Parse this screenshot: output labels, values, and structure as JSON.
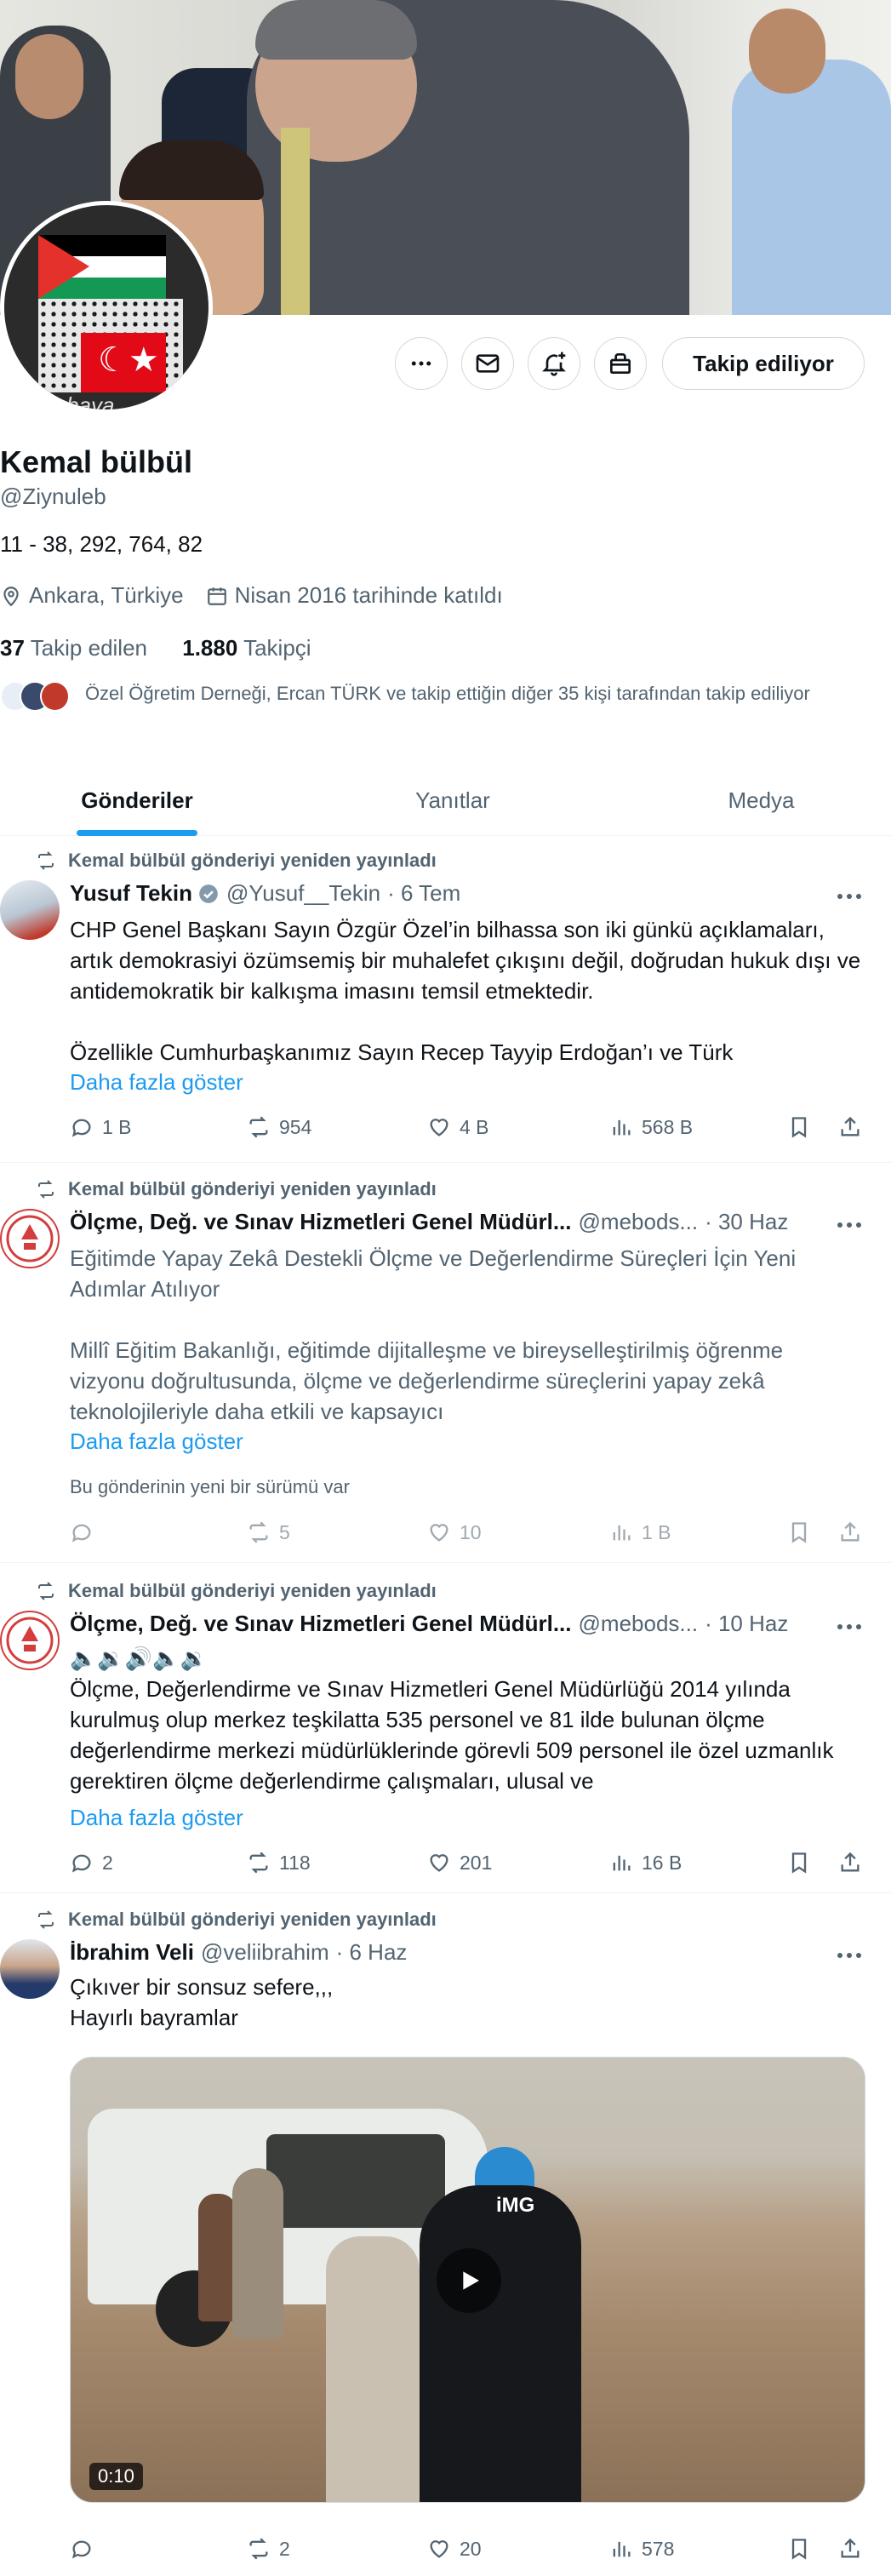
{
  "profile": {
    "name": "Kemal bülbül",
    "handle": "@Ziynuleb",
    "bio": "11 - 38, 292, 764, 82",
    "location": "Ankara, Türkiye",
    "joined": "Nisan 2016 tarihinde katıldı",
    "following_count": "37",
    "following_label": "Takip edilen",
    "followers_count": "1.880",
    "followers_label": "Takipçi",
    "followed_by": "Özel Öğretim Derneği, Ercan TÜRK ve takip ettiğin diğer 35 kişi tarafından takip ediliyor",
    "avatar_watermark": "ncerebaya"
  },
  "actions": {
    "more_icon": "more-icon",
    "message_icon": "mail-icon",
    "notify_icon": "bell-plus-icon",
    "subscribe_icon": "gift-icon",
    "follow_label": "Takip ediliyor"
  },
  "tabs": [
    {
      "label": "Gönderiler",
      "active": true
    },
    {
      "label": "Yanıtlar",
      "active": false
    },
    {
      "label": "Medya",
      "active": false
    }
  ],
  "posts": [
    {
      "repost_label": "Kemal bülbül gönderiyi yeniden yayınladı",
      "author": "Yusuf Tekin",
      "handle": "@Yusuf__Tekin",
      "time": "· 6 Tem",
      "verified": true,
      "body1": "CHP Genel Başkanı Sayın Özgür Özel’in bilhassa son iki günkü açıklamaları, artık demokrasiyi özümsemiş bir muhalefet çıkışını değil, doğrudan hukuk dışı ve antidemokratik bir kalkışma imasını temsil etmektedir.",
      "body2": "Özellikle Cumhurbaşkanımız Sayın Recep Tayyip Erdoğan’ı ve Türk",
      "show_more": "Daha fazla göster",
      "replies": "1 B",
      "reposts": "954",
      "likes": "4 B",
      "views": "568 B"
    },
    {
      "repost_label": "Kemal bülbül gönderiyi yeniden yayınladı",
      "author": "Ölçme, Değ. ve Sınav Hizmetleri Genel Müdürl...",
      "handle": "@mebods...",
      "time": "· 30 Haz",
      "body1": "Eğitimde Yapay Zekâ Destekli Ölçme ve Değerlendirme Süreçleri İçin Yeni Adımlar Atılıyor",
      "body2": "Millî Eğitim Bakanlığı, eğitimde dijitalleşme ve bireyselleştirilmiş öğrenme vizyonu doğrultusunda, ölçme ve değerlendirme süreçlerini yapay zekâ teknolojileriyle daha etkili ve kapsayıcı",
      "show_more": "Daha fazla göster",
      "new_version": "Bu gönderinin yeni bir sürümü var",
      "replies": "",
      "reposts": "5",
      "likes": "10",
      "views": "1 B"
    },
    {
      "repost_label": "Kemal bülbül gönderiyi yeniden yayınladı",
      "author": "Ölçme, Değ. ve Sınav Hizmetleri Genel Müdürl...",
      "handle": "@mebods...",
      "time": "· 10 Haz",
      "emoji_line": "🔈🔉🔊🔈🔉",
      "body1": "Ölçme, Değerlendirme ve Sınav Hizmetleri Genel Müdürlüğü 2014 yılında kurulmuş olup merkez teşkilatta 535 personel ve 81 ilde bulunan ölçme değerlendirme merkezi müdürlüklerinde görevli 509 personel ile özel uzmanlık gerektiren ölçme değerlendirme çalışmaları, ulusal ve",
      "show_more": "Daha fazla göster",
      "replies": "2",
      "reposts": "118",
      "likes": "201",
      "views": "16 B"
    },
    {
      "repost_label": "Kemal bülbül gönderiyi yeniden yayınladı",
      "author": "İbrahim Veli",
      "handle": "@veliibrahim",
      "time": "· 6 Haz",
      "body1": "Çıkıver bir sonsuz sefere,,,",
      "body2": "Hayırlı bayramlar",
      "media_logo": "iMG",
      "video_duration": "0:10",
      "replies": "",
      "reposts": "2",
      "likes": "20",
      "views": "578"
    }
  ],
  "colors": {
    "accent": "#1d9bf0",
    "text": "#0f1419",
    "secondary": "#536471",
    "border": "#cfd9de"
  }
}
